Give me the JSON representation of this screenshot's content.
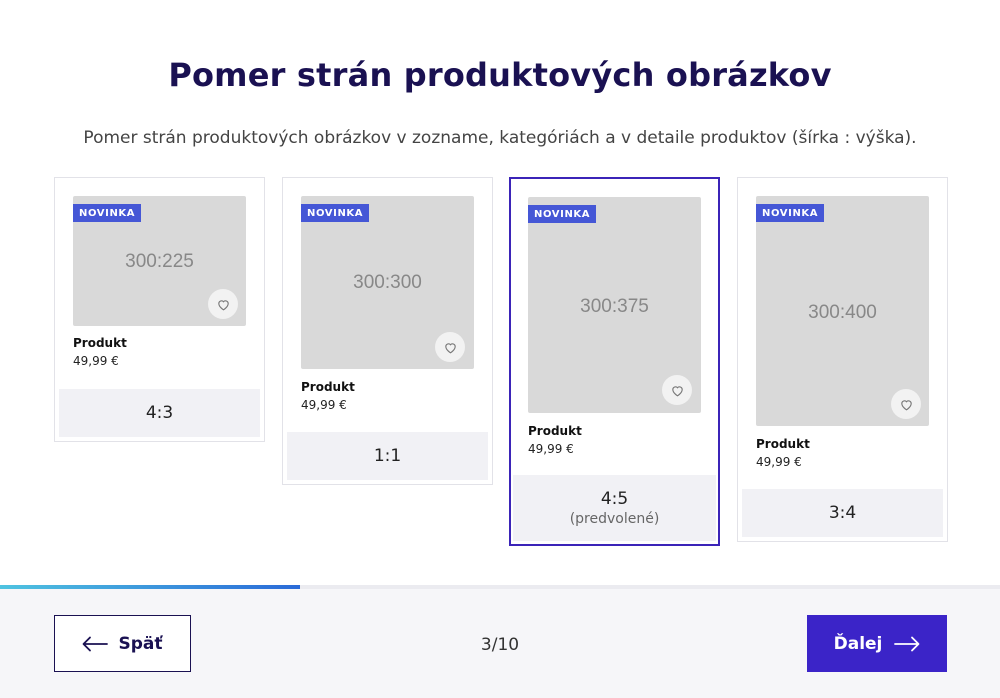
{
  "header": {
    "title": "Pomer strán produktových obrázkov",
    "subtitle": "Pomer strán produktových obrázkov v zozname, kategóriách a v detaile produktov (šírka : výška)."
  },
  "options": [
    {
      "badge": "NOVINKA",
      "image_ratio": "300:225",
      "product_name": "Produkt",
      "price": "49,99 €",
      "label": "4:3",
      "note": "",
      "selected": false,
      "icon": "heart-icon"
    },
    {
      "badge": "NOVINKA",
      "image_ratio": "300:300",
      "product_name": "Produkt",
      "price": "49,99 €",
      "label": "1:1",
      "note": "",
      "selected": false,
      "icon": "heart-icon"
    },
    {
      "badge": "NOVINKA",
      "image_ratio": "300:375",
      "product_name": "Produkt",
      "price": "49,99 €",
      "label": "4:5",
      "note": "(predvolené)",
      "selected": true,
      "icon": "heart-icon"
    },
    {
      "badge": "NOVINKA",
      "image_ratio": "300:400",
      "product_name": "Produkt",
      "price": "49,99 €",
      "label": "3:4",
      "note": "",
      "selected": false,
      "icon": "heart-icon"
    }
  ],
  "progress": {
    "fraction": 0.3
  },
  "footer": {
    "back_label": "Späť",
    "back_icon": "arrow-left-icon",
    "next_label": "Ďalej",
    "next_icon": "arrow-right-icon",
    "step": "3/10"
  },
  "colors": {
    "accent": "#3b24c8",
    "title": "#1a1152",
    "badge": "#4557d6",
    "thumb": "#d9d9d9"
  }
}
